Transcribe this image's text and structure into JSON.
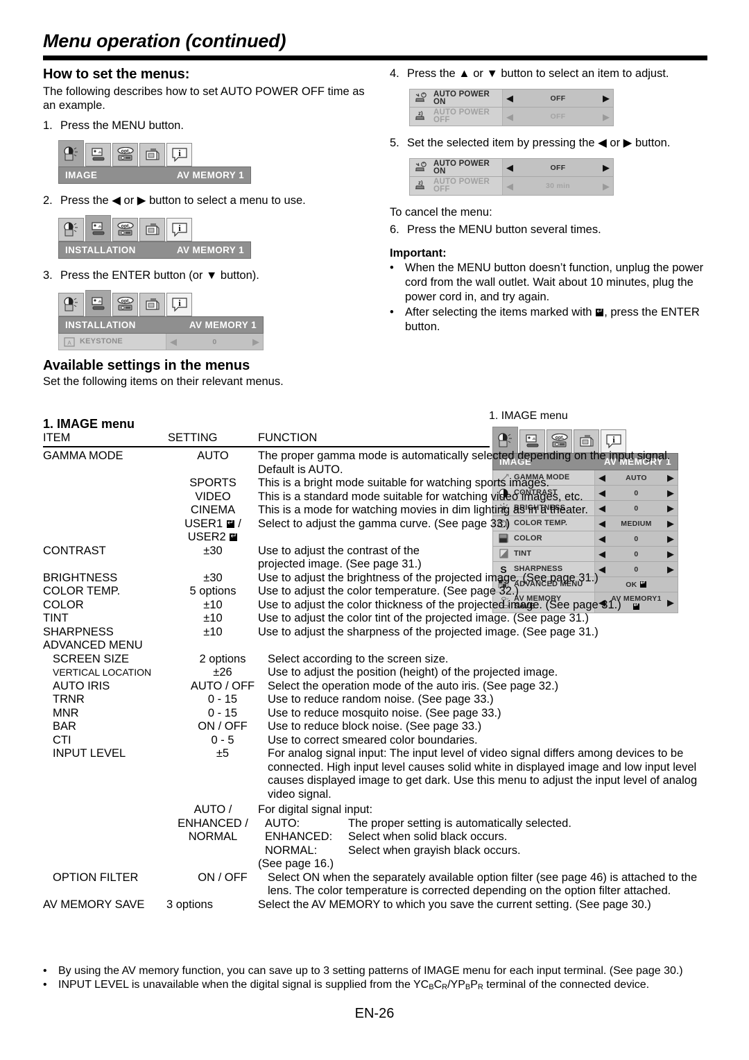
{
  "page": {
    "title": "Menu operation (continued)",
    "page_number": "EN-26"
  },
  "left": {
    "section_title": "How to set the menus:",
    "intro": "The following describes how to set AUTO POWER OFF time as an example.",
    "steps": [
      {
        "num": "1.",
        "text": "Press the MENU button."
      },
      {
        "num": "2.",
        "text": "Press the ◀ or ▶ button to select a menu to use."
      },
      {
        "num": "3.",
        "text": "Press the ENTER button (or ▼ button)."
      }
    ],
    "osd1": {
      "title_left": "IMAGE",
      "title_right": "AV MEMORY 1"
    },
    "osd2": {
      "title_left": "INSTALLATION",
      "title_right": "AV MEMORY 1"
    },
    "osd3": {
      "title_left": "INSTALLATION",
      "title_right": "AV MEMORY 1",
      "row_label": "KEYSTONE",
      "row_value": "0"
    }
  },
  "right": {
    "steps": [
      {
        "num": "4.",
        "text": "Press the ▲ or ▼ button to select an item to adjust."
      },
      {
        "num": "5.",
        "text": "Set the selected item by pressing the ◀ or ▶ button."
      }
    ],
    "cancel_heading": "To cancel the menu:",
    "step6": {
      "num": "6.",
      "text": "Press the MENU button several times."
    },
    "important_label": "Important:",
    "important_bullets": [
      "When the MENU button doesn’t function, unplug the power cord from the wall outlet. Wait about 10 minutes, plug the power cord in, and try again.",
      "After selecting the items marked with ⮐, press the ENTER button."
    ],
    "autopower_a": {
      "rows": [
        {
          "label1": "AUTO POWER",
          "label2": "ON",
          "value": "OFF",
          "dim": false
        },
        {
          "label1": "AUTO POWER",
          "label2": "OFF",
          "value": "OFF",
          "dim": true
        }
      ]
    },
    "autopower_b": {
      "rows": [
        {
          "label1": "AUTO POWER",
          "label2": "ON",
          "value": "OFF",
          "dim": false
        },
        {
          "label1": "AUTO POWER",
          "label2": "OFF",
          "value": "30 min",
          "dim": true
        }
      ]
    }
  },
  "available": {
    "heading": "Available settings in the menus",
    "subtext": "Set the following items on their relevant menus.",
    "menu_heading": "1. IMAGE menu",
    "shot_caption": "1. IMAGE menu"
  },
  "image_menu_shot": {
    "title_left": "IMAGE",
    "title_right": "AV MEMORY 1",
    "rows": [
      {
        "icon": "gamma-curve-icon",
        "label": "GAMMA MODE",
        "value": "AUTO",
        "arrows": true
      },
      {
        "icon": "contrast-icon",
        "label": "CONTRAST",
        "value": "0",
        "arrows": true
      },
      {
        "icon": "brightness-sun-icon",
        "label": "BRIGHTNESS",
        "value": "0",
        "arrows": true
      },
      {
        "icon": "color-temp-icon",
        "label": "COLOR TEMP.",
        "value": "MEDIUM",
        "arrows": true
      },
      {
        "icon": "color-icon",
        "label": "COLOR",
        "value": "0",
        "arrows": true
      },
      {
        "icon": "tint-icon",
        "label": "TINT",
        "value": "0",
        "arrows": true
      },
      {
        "icon": "sharpness-s-icon",
        "label": "SHARPNESS",
        "value": "0",
        "arrows": true
      },
      {
        "icon": "advanced-menu-icon",
        "label": "ADVANCED MENU",
        "value": "OK",
        "arrows": false,
        "enter": true
      },
      {
        "icon": "av-memory-save-icon",
        "label": "AV MEMORY",
        "label2": "SAVE",
        "value": "AV MEMORY1",
        "arrows": true,
        "enter": true
      }
    ]
  },
  "table": {
    "headers": {
      "item": "ITEM",
      "setting": "SETTING",
      "function": "FUNCTION"
    },
    "rows": [
      {
        "item": "GAMMA MODE",
        "setting": "AUTO",
        "function": "The proper gamma mode is automatically selected depending on the input signal. Default is AUTO."
      },
      {
        "item": "",
        "setting": "SPORTS",
        "function": "This is a bright mode suitable for watching sports images."
      },
      {
        "item": "",
        "setting": "VIDEO",
        "function": "This is a standard mode suitable for watching video images, etc."
      },
      {
        "item": "",
        "setting": "CINEMA",
        "function": "This is a mode for watching movies in dim lighting as in a theater."
      },
      {
        "item": "",
        "setting": "USER1 ⮐ /\nUSER2 ⮐",
        "function": "Select to adjust the gamma curve. (See page 33.)"
      },
      {
        "item": "CONTRAST",
        "setting": "±30",
        "function": "Use to adjust the contrast of the projected image. (See page 31.)"
      },
      {
        "item": "BRIGHTNESS",
        "setting": "±30",
        "function": "Use to adjust the brightness of the projected image. (See page 31.)"
      },
      {
        "item": "COLOR TEMP.",
        "setting": "5 options",
        "function": "Use to adjust the color temperature. (See page 32.)"
      },
      {
        "item": "COLOR",
        "setting": "±10",
        "function": "Use to adjust the color thickness of the projected image. (See page 31.)"
      },
      {
        "item": "TINT",
        "setting": "±10",
        "function": "Use to adjust the color tint of the projected image. (See page 31.)"
      },
      {
        "item": "SHARPNESS",
        "setting": "±10",
        "function": "Use to adjust the sharpness of the projected image. (See page 31.)"
      },
      {
        "item": "ADVANCED MENU",
        "setting": "",
        "function": ""
      },
      {
        "item": "SCREEN SIZE",
        "setting": "2 options",
        "function": "Select according to the screen size.",
        "indent": true
      },
      {
        "item": "VERTICAL LOCATION",
        "setting": "±26",
        "function": "Use to adjust the position (height) of the projected image.",
        "indent": true,
        "small": true
      },
      {
        "item": "AUTO IRIS",
        "setting": "AUTO / OFF",
        "function": "Select the operation mode of the auto iris. (See page 32.)",
        "indent": true
      },
      {
        "item": "TRNR",
        "setting": "0 - 15",
        "function": "Use to reduce random noise. (See page 33.)",
        "indent": true
      },
      {
        "item": "MNR",
        "setting": "0 - 15",
        "function": "Use to reduce mosquito noise. (See page 33.)",
        "indent": true
      },
      {
        "item": "BAR",
        "setting": "ON / OFF",
        "function": "Use to reduce block noise. (See page 33.)",
        "indent": true
      },
      {
        "item": "CTI",
        "setting": "0 - 5",
        "function": "Use to correct smeared color boundaries.",
        "indent": true
      },
      {
        "item": "INPUT LEVEL",
        "setting": "±5",
        "function": "For analog signal input: The input level of video signal differs among devices to be connected. High input level causes solid white in displayed image and low input level causes displayed image to get dark. Use this menu to adjust the input level of analog video signal.",
        "indent": true
      }
    ],
    "digital_row": {
      "setting": "AUTO /\nENHANCED /\nNORMAL",
      "intro": "For digital signal input:",
      "lines": [
        {
          "key": "AUTO:",
          "desc": "The proper setting is automatically selected."
        },
        {
          "key": "ENHANCED:",
          "desc": "Select when solid black occurs."
        },
        {
          "key": "NORMAL:",
          "desc": "Select when grayish black occurs."
        }
      ],
      "footer": "(See page 16.)"
    },
    "option_filter": {
      "item": "OPTION FILTER",
      "setting": "ON / OFF",
      "function": "Select ON when the separately available option filter (see page 46) is attached to the lens. The color temperature is corrected depending on the option filter attached."
    },
    "av_memory_save": {
      "item": "AV MEMORY SAVE",
      "setting": "3 options",
      "function": "Select the AV MEMORY to which you save the current setting. (See page 30.)"
    }
  },
  "notes": [
    "By using the AV memory function, you can save up to 3 setting patterns of IMAGE menu for each input terminal. (See page 30.)",
    "INPUT LEVEL is unavailable when the digital signal is supplied from the YCBCR/YPBPR terminal of the connected device."
  ],
  "colors": {
    "osd_title_bar": "#8f8f8f",
    "osd_row": "#d2d2d2",
    "osd_value": "#c2c2c2",
    "tab_selected": "#a6a6a6",
    "tab_normal": "#c9c9c9",
    "rule": "#000000"
  }
}
